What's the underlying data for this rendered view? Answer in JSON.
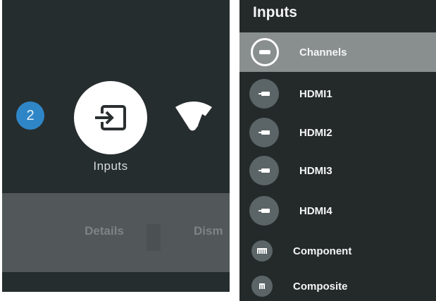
{
  "left_panel": {
    "badge_count": "2",
    "inputs_label": "Inputs",
    "details_label": "Details",
    "dismiss_label": "Dism"
  },
  "right_panel": {
    "title": "Inputs",
    "items": [
      {
        "label": "Channels",
        "icon": "tv-tuner-icon",
        "selected": true
      },
      {
        "label": "HDMI1",
        "icon": "hdmi-icon"
      },
      {
        "label": "HDMI2",
        "icon": "hdmi-icon"
      },
      {
        "label": "HDMI3",
        "icon": "hdmi-icon"
      },
      {
        "label": "HDMI4",
        "icon": "hdmi-icon"
      },
      {
        "label": "Component",
        "icon": "component-icon"
      },
      {
        "label": "Composite",
        "icon": "composite-icon"
      }
    ]
  },
  "colors": {
    "badge": "#2f86c7",
    "panel_bg": "#24292a",
    "selected_bg": "#898e8f"
  }
}
